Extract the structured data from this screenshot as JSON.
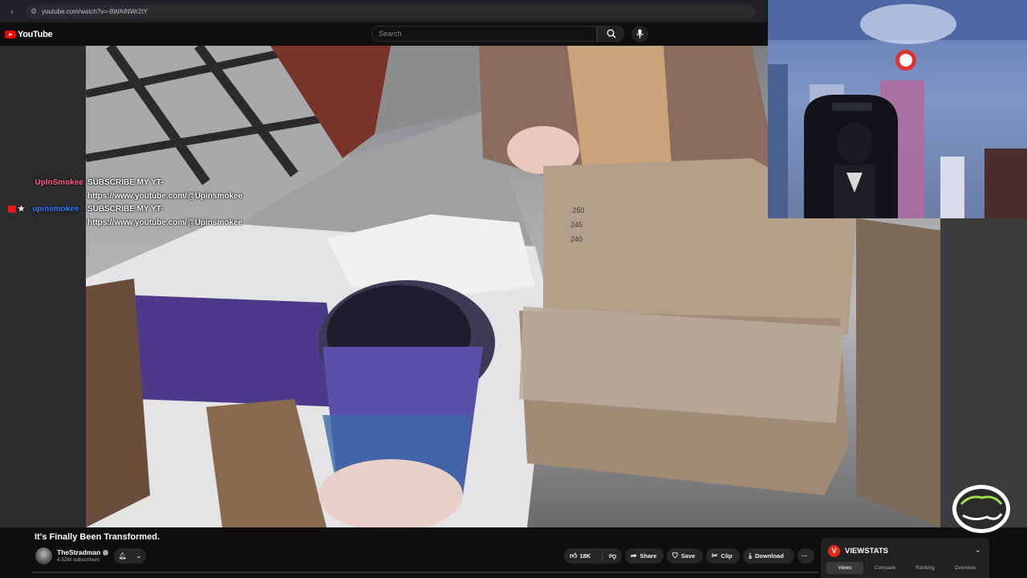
{
  "browser": {
    "back_icon": "‹",
    "reload_icon": "↻",
    "url": "youtube.com/watch?v=-8WAINWr2tY"
  },
  "youtube": {
    "logo_text": "YouTube",
    "search_placeholder": "Search"
  },
  "webcam": {},
  "chat": [
    {
      "username": "UpInSmokee",
      "username_color": "#ff5a8c",
      "message": "SUBSCRIBE MY YT- https://www.youtube.com/@Upinsmokee"
    },
    {
      "username": "upinsmokee_",
      "username_color": "#2f82ff",
      "message": "SUBSCRIBE MY YT- https://www.youtube.com/@Upinsmokee"
    }
  ],
  "box_numbers": [
    ".250",
    "245",
    "240"
  ],
  "video": {
    "title": "It's Finally Been Transformed.",
    "channel": "TheStradman",
    "subscribers": "4.52M subscribers"
  },
  "actions": {
    "likes": "18K",
    "share": "Share",
    "save": "Save",
    "clip": "Clip",
    "download": "Download",
    "more": "···"
  },
  "viewstats": {
    "title": "VIEWSTATS",
    "logo": "V",
    "tabs": [
      "Views",
      "Compare",
      "Ranking",
      "Overview"
    ],
    "active_tab": "Views"
  },
  "colors": {
    "yt_red": "#ff0000",
    "bg": "#0f0f0f",
    "viewstats_red": "#e5291d"
  }
}
